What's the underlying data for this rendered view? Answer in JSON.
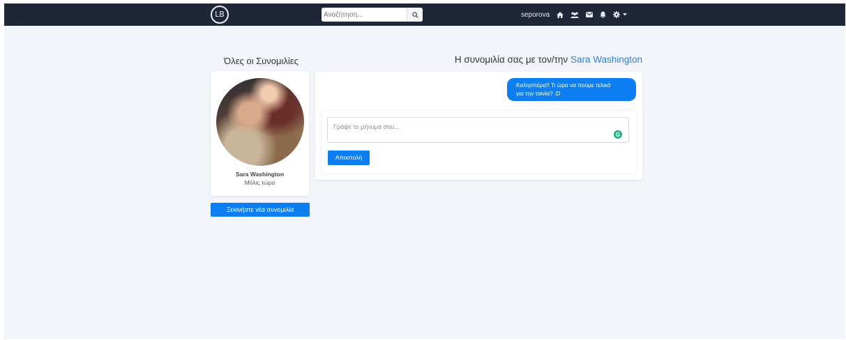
{
  "navbar": {
    "logo_text": "LB",
    "search_placeholder": "Αναζήτηση...",
    "username": "seporova",
    "icons": [
      "search-icon",
      "home-icon",
      "friends-icon",
      "messages-icon",
      "notifications-icon",
      "settings-icon",
      "caret-down-icon"
    ]
  },
  "sidebar": {
    "title": "Όλες οι Συνομιλίες",
    "contacts": [
      {
        "name": "Sara Washington",
        "status": "Μόλις τώρα"
      }
    ],
    "new_conversation_label": "Ξεκινήστε νέα συνομιλία"
  },
  "chat": {
    "title_prefix": "Η συνομιλία σας με τον/την",
    "partner_name": "Sara Washington",
    "messages": [
      {
        "text_line1": "Καλησπέρα!! Τι ώρα να πούμε τελικά",
        "text_line2": "για την ταινία? :D",
        "from_me": true
      }
    ],
    "input_placeholder": "Γράψε το μήνυμα σου...",
    "send_label": "Αποστολή"
  },
  "colors": {
    "navbar": "#1e2637",
    "accent": "#0d7ff3",
    "background": "#f2f5fa",
    "link": "#2f7fe0"
  }
}
